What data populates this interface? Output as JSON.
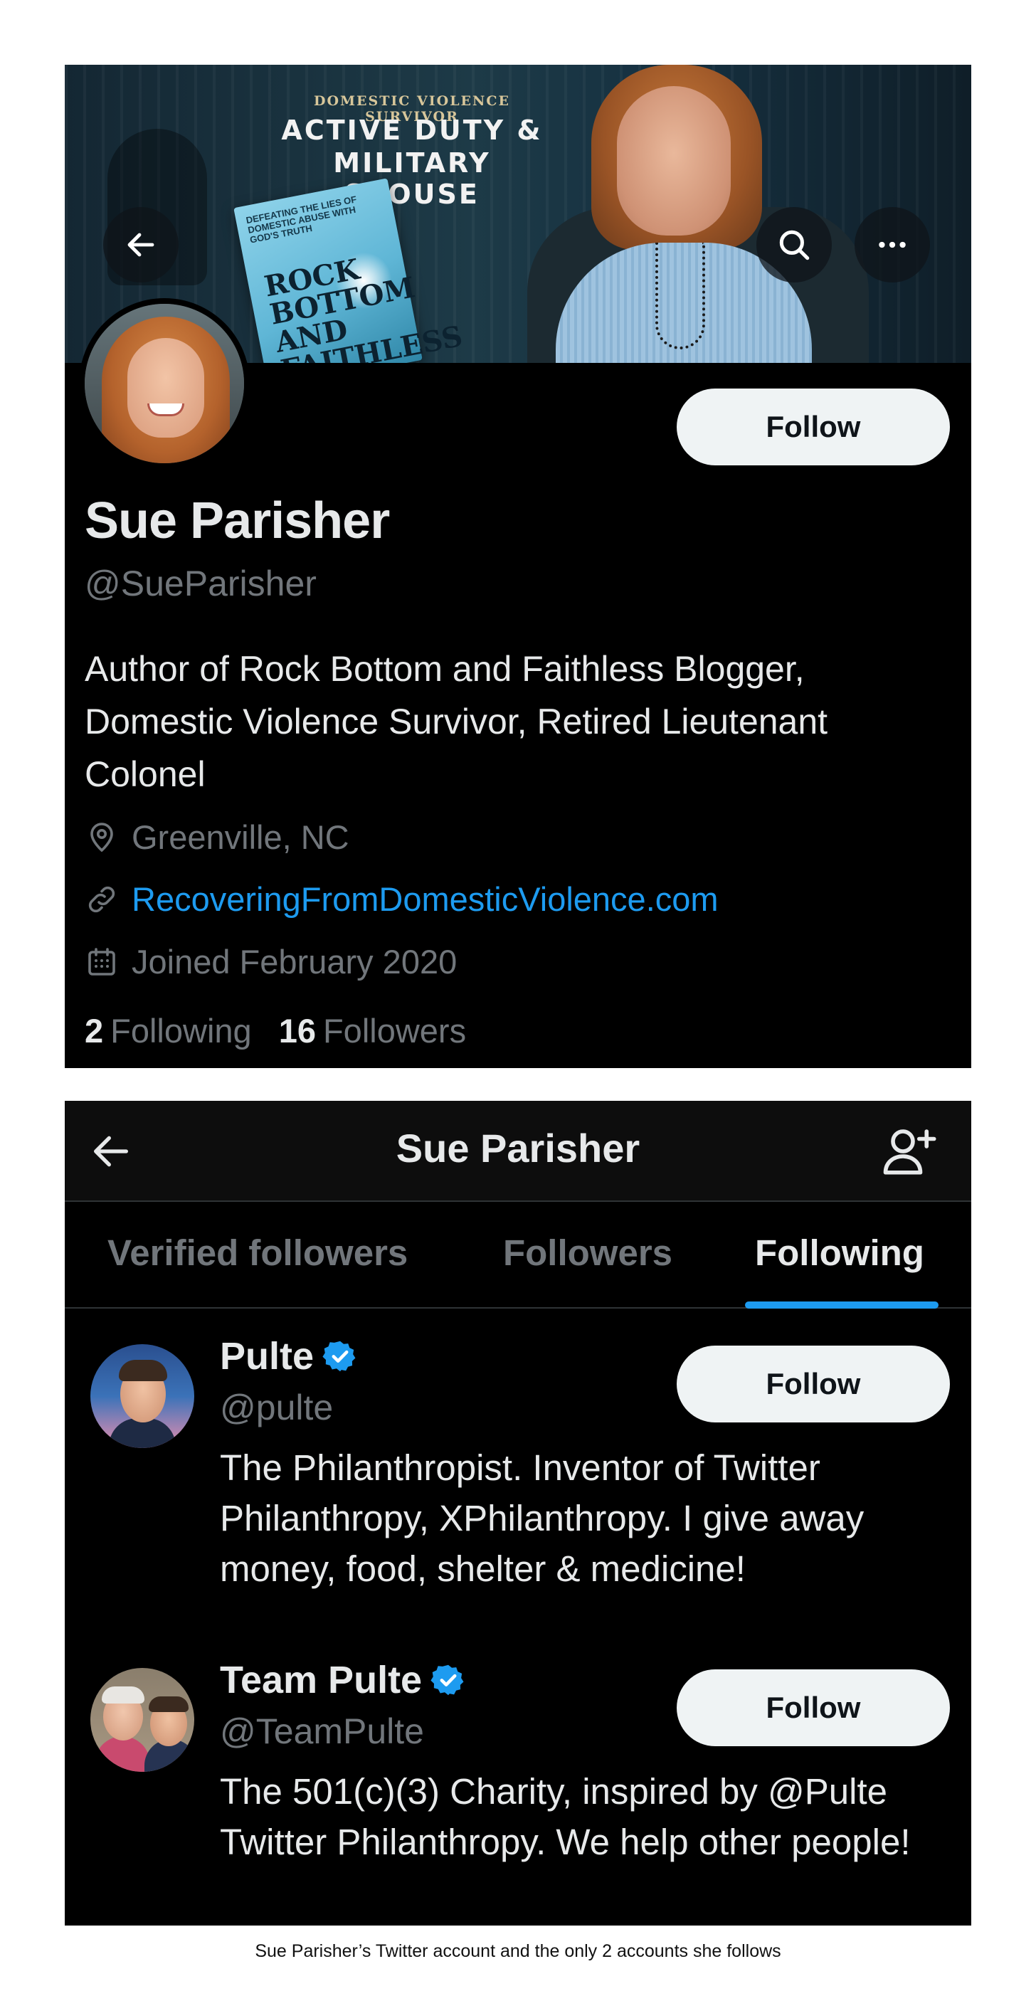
{
  "profile": {
    "banner": {
      "kicker": "DOMESTIC VIOLENCE SURVIVOR",
      "headline_line1": "ACTIVE DUTY &",
      "headline_line2": "MILITARY SPOUSE",
      "book_subtitle": "DEFEATING THE LIES OF DOMESTIC ABUSE WITH GOD'S TRUTH",
      "book_title": "ROCK BOTTOM AND FAITHLESS"
    },
    "follow_label": "Follow",
    "display_name": "Sue Parisher",
    "handle": "@SueParisher",
    "bio": "Author of Rock Bottom and Faithless Blogger, Domestic Violence Survivor, Retired Lieutenant Colonel",
    "location": "Greenville, NC",
    "website": "RecoveringFromDomesticViolence.com",
    "joined": "Joined February 2020",
    "following_count": "2",
    "following_label": "Following",
    "followers_count": "16",
    "followers_label": "Followers"
  },
  "following_page": {
    "title": "Sue Parisher",
    "tabs": [
      {
        "label": "Verified followers",
        "active": false
      },
      {
        "label": "Followers",
        "active": false
      },
      {
        "label": "Following",
        "active": true
      }
    ],
    "users": [
      {
        "name": "Pulte",
        "verified": true,
        "handle": "@pulte",
        "bio": "The Philanthropist. Inventor of Twitter Philanthropy, XPhilanthropy. I give away money, food, shelter & medicine!",
        "follow_label": "Follow"
      },
      {
        "name": "Team Pulte",
        "verified": true,
        "handle": "@TeamPulte",
        "bio": "The 501(c)(3) Charity, inspired by @Pulte Twitter Philanthropy. We help other people!",
        "follow_label": "Follow"
      }
    ]
  },
  "caption": "Sue Parisher’s Twitter account and the only 2 accounts she follows",
  "colors": {
    "accent": "#1d9bf0",
    "background": "#000000",
    "text_primary": "#e7e9ea",
    "text_secondary": "#71767b",
    "button_bg": "#eff3f4"
  },
  "icons": {
    "banner_back": "arrow-left-icon",
    "banner_search": "search-icon",
    "banner_more": "more-horizontal-icon",
    "location": "location-pin-icon",
    "link": "link-icon",
    "calendar": "calendar-icon",
    "top_back": "arrow-left-icon",
    "add_user": "add-user-icon",
    "verified": "verified-badge-icon"
  }
}
